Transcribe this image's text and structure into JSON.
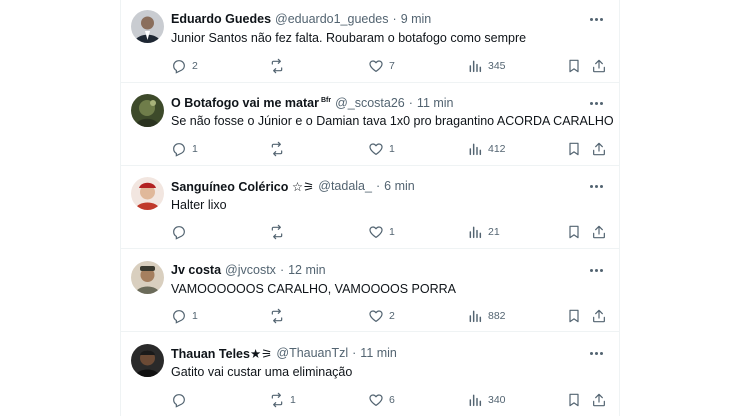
{
  "tweets": [
    {
      "name": "Eduardo Guedes",
      "badge": "",
      "handle": "@eduardo1_guedes",
      "separator": "·",
      "time": "9 min",
      "text": "Junior Santos não fez falta. Roubaram o botafogo como sempre",
      "replies": "2",
      "retweets": "",
      "likes": "7",
      "views": "345"
    },
    {
      "name": "O Botafogo vai me matar",
      "badge": "Bfr",
      "handle": "@_scosta26",
      "separator": "·",
      "time": "11 min",
      "text": "Se não fosse o Júnior e o Damian tava 1x0 pro bragantino ACORDA CARALHO",
      "replies": "1",
      "retweets": "",
      "likes": "1",
      "views": "412"
    },
    {
      "name": "Sanguíneo Colérico ☆⚞",
      "badge": "",
      "handle": "@tadala_",
      "separator": "·",
      "time": "6 min",
      "text": "Halter lixo",
      "replies": "",
      "retweets": "",
      "likes": "1",
      "views": "21"
    },
    {
      "name": "Jv costa",
      "badge": "",
      "handle": "@jvcostx",
      "separator": "·",
      "time": "12 min",
      "text": "VAMOOOOOOS CARALHO, VAMOOOOS PORRA",
      "replies": "1",
      "retweets": "",
      "likes": "2",
      "views": "882"
    },
    {
      "name": "Thauan Teles★⚞",
      "badge": "",
      "handle": "@ThauanTzl",
      "separator": "·",
      "time": "11 min",
      "text": "Gatito vai custar uma eliminação",
      "replies": "",
      "retweets": "1",
      "likes": "6",
      "views": "340"
    }
  ],
  "icons": {
    "reply": "reply-icon",
    "retweet": "retweet-icon",
    "like": "heart-icon",
    "views": "views-icon",
    "bookmark": "bookmark-icon",
    "share": "share-icon",
    "more": "more-icon"
  },
  "colors": {
    "text": "#0f1419",
    "secondary": "#536471",
    "divider": "#eff3f4"
  }
}
